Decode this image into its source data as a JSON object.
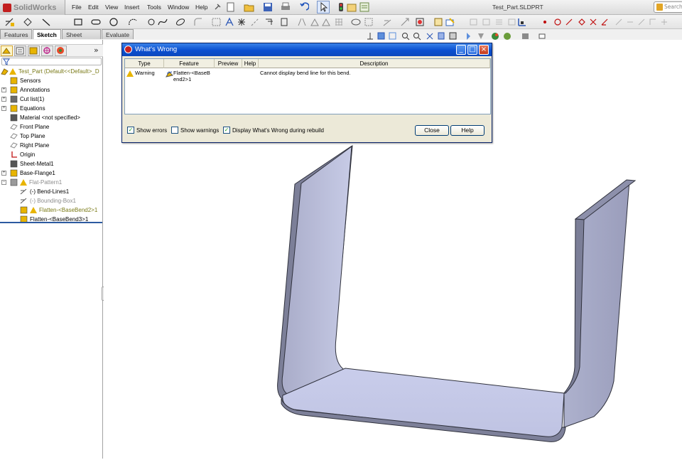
{
  "app": {
    "name": "SolidWorks",
    "document_title": "Test_Part.SLDPRT",
    "search_placeholder": "Search"
  },
  "menu": [
    "File",
    "Edit",
    "View",
    "Insert",
    "Tools",
    "Window",
    "Help"
  ],
  "command_tabs": [
    {
      "label": "Features",
      "active": false
    },
    {
      "label": "Sketch",
      "active": true
    },
    {
      "label": "Sheet Metal",
      "active": false
    },
    {
      "label": "Evaluate",
      "active": false
    }
  ],
  "feature_tree": {
    "root": "Test_Part  (Default<<Default>_D",
    "items": [
      {
        "label": "Sensors",
        "icon": "sensors-icon",
        "expander": false
      },
      {
        "label": "Annotations",
        "icon": "annotations-icon",
        "expander": true
      },
      {
        "label": "Cut list(1)",
        "icon": "cut-list-icon",
        "expander": true
      },
      {
        "label": "Equations",
        "icon": "equations-icon",
        "expander": true
      },
      {
        "label": "Material <not specified>",
        "icon": "material-icon",
        "expander": false
      },
      {
        "label": "Front Plane",
        "icon": "plane-icon",
        "expander": false
      },
      {
        "label": "Top Plane",
        "icon": "plane-icon",
        "expander": false
      },
      {
        "label": "Right Plane",
        "icon": "plane-icon",
        "expander": false
      },
      {
        "label": "Origin",
        "icon": "origin-icon",
        "expander": false
      },
      {
        "label": "Sheet-Metal1",
        "icon": "sheet-metal-icon",
        "expander": false
      },
      {
        "label": "Base-Flange1",
        "icon": "base-flange-icon",
        "expander": true
      },
      {
        "label": "Flat-Pattern1",
        "icon": "flat-pattern-icon",
        "expander": true
      },
      {
        "label": "(-) Bend-Lines1",
        "icon": "sketch-icon",
        "expander": false
      },
      {
        "label": "(-) Bounding-Box1",
        "icon": "sketch-icon",
        "expander": false
      },
      {
        "label": "Flatten-<BaseBend2>1",
        "icon": "flatten-icon",
        "expander": false
      },
      {
        "label": "Flatten-<BaseBend3>1",
        "icon": "flatten-icon",
        "expander": false
      }
    ]
  },
  "dialog": {
    "title": "What's Wrong",
    "columns": [
      "Type",
      "Feature",
      "Preview",
      "Help",
      "Description"
    ],
    "rows": [
      {
        "type": "Warning",
        "feature_line1": "Flatten-<BaseB",
        "feature_line2": "end2>1",
        "description": "Cannot display bend line for this bend."
      }
    ],
    "options": [
      {
        "label": "Show errors",
        "checked": true
      },
      {
        "label": "Show warnings",
        "checked": false
      },
      {
        "label": "Display What's Wrong during rebuild",
        "checked": true
      }
    ],
    "close_label": "Close",
    "help_label": "Help"
  },
  "colors": {
    "title_bar": "#0a4fd0",
    "warning": "#e8b400",
    "part_face": "#c5cae8",
    "part_edge": "#3a3c4a"
  }
}
